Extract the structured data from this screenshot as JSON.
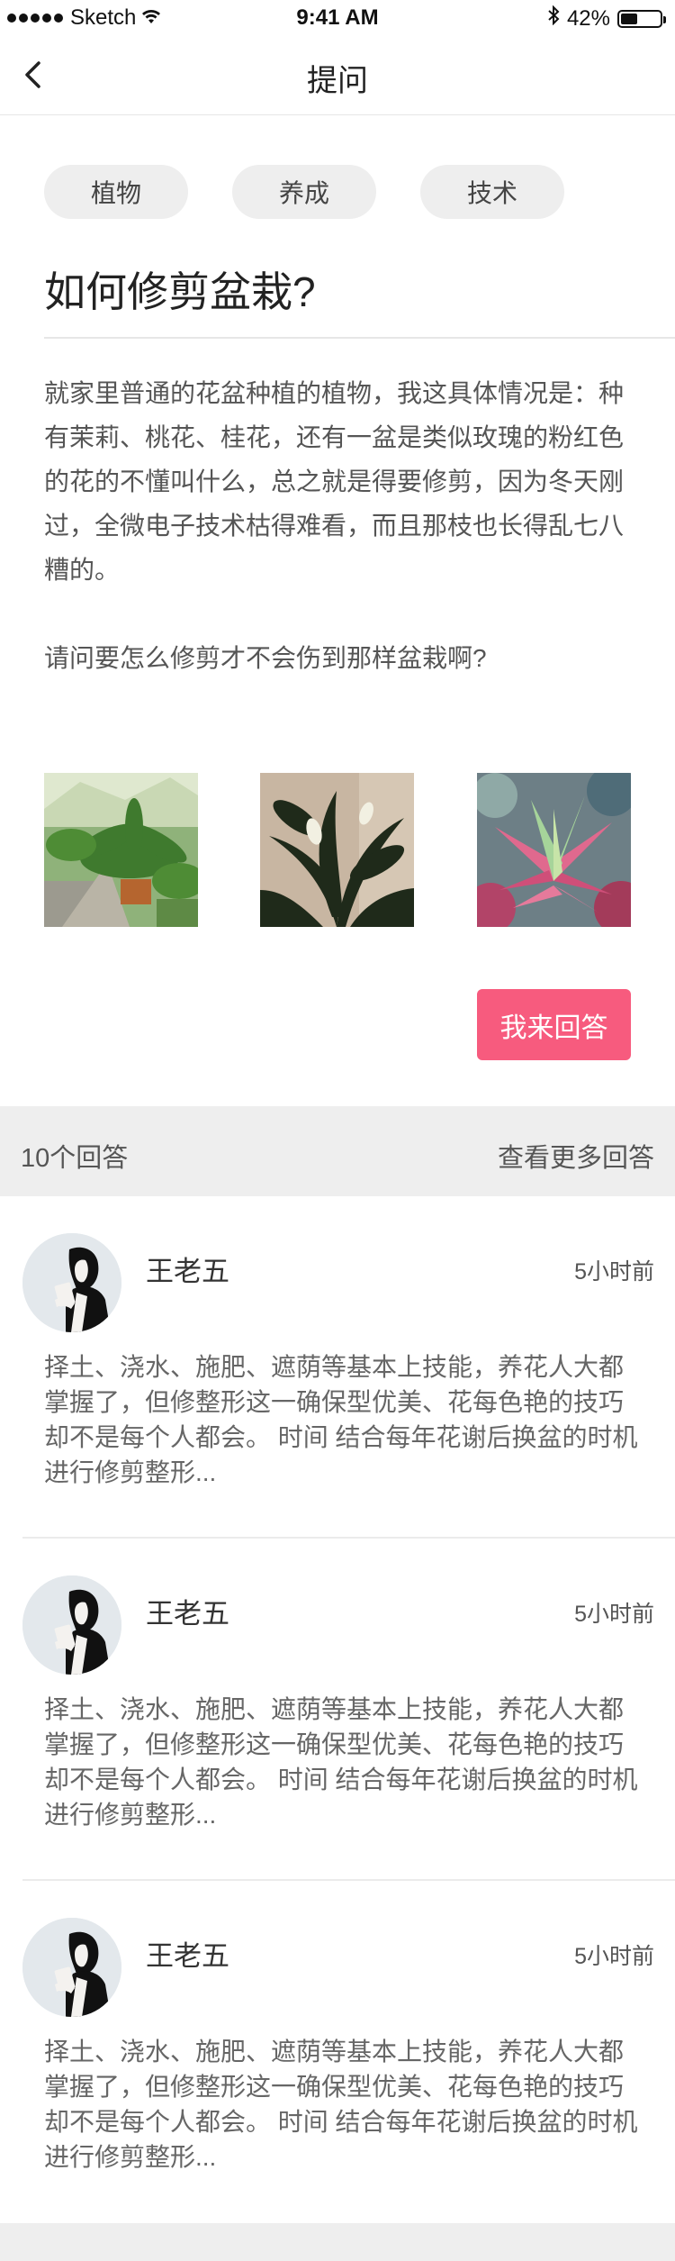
{
  "status_bar": {
    "carrier": "Sketch",
    "time": "9:41 AM",
    "battery": "42%",
    "battery_level": 0.42
  },
  "nav": {
    "title": "提问",
    "back_icon": "chevron-left-icon"
  },
  "tags": [
    "植物",
    "养成",
    "技术"
  ],
  "question": {
    "title": "如何修剪盆栽?",
    "paragraphs": [
      "就家里普通的花盆种植的植物，我这具体情况是：种有茉莉、桃花、桂花，还有一盆是类似玫瑰的粉红色的花的不懂叫什么，总之就是得要修剪，因为冬天刚过，全微电子技术枯得难看，而且那枝也长得乱七八糟的。",
      "请问要怎么修剪才不会伤到那样盆栽啊?"
    ]
  },
  "answer_button": "我来回答",
  "colors": {
    "accent": "#f75b7e",
    "tag_bg": "#eeeeee",
    "section_bg": "#eeeeee"
  },
  "answers_header": {
    "count_label": "10个回答",
    "more_label": "查看更多回答"
  },
  "answers": [
    {
      "name": "王老五",
      "time": "5小时前",
      "text": "择土、浇水、施肥、遮荫等基本上技能，养花人大都掌握了，但修整形这一确保型优美、花每色艳的技巧却不是每个人都会。 时间 结合每年花谢后换盆的时机进行修剪整形..."
    },
    {
      "name": "王老五",
      "time": "5小时前",
      "text": "择土、浇水、施肥、遮荫等基本上技能，养花人大都掌握了，但修整形这一确保型优美、花每色艳的技巧却不是每个人都会。 时间 结合每年花谢后换盆的时机进行修剪整形..."
    },
    {
      "name": "王老五",
      "time": "5小时前",
      "text": "择土、浇水、施肥、遮荫等基本上技能，养花人大都掌握了，但修整形这一确保型优美、花每色艳的技巧却不是每个人都会。 时间 结合每年花谢后换盆的时机进行修剪整形..."
    }
  ]
}
